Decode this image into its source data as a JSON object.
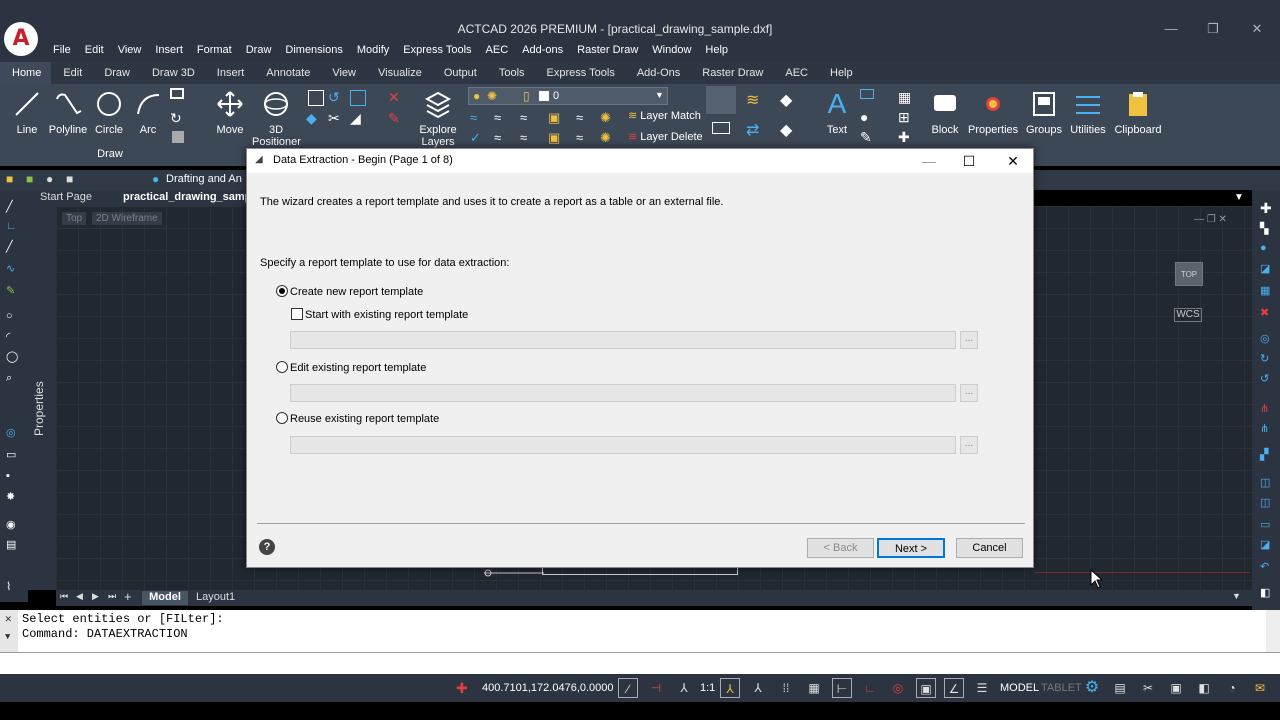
{
  "window": {
    "title": "ACTCAD 2026 PREMIUM - [practical_drawing_sample.dxf]"
  },
  "menu": [
    "File",
    "Edit",
    "View",
    "Insert",
    "Format",
    "Draw",
    "Dimensions",
    "Modify",
    "Express Tools",
    "AEC",
    "Add-ons",
    "Raster Draw",
    "Window",
    "Help"
  ],
  "ribbon_tabs": [
    "Home",
    "Edit",
    "Draw",
    "Draw 3D",
    "Insert",
    "Annotate",
    "View",
    "Visualize",
    "Output",
    "Tools",
    "Express Tools",
    "Add-Ons",
    "Raster Draw",
    "AEC",
    "Help"
  ],
  "ribbon": {
    "line": "Line",
    "polyline": "Polyline",
    "circle": "Circle",
    "arc": "Arc",
    "move": "Move",
    "positioner": "3D Positioner",
    "explore_layers": "Explore Layers",
    "layer_current": "0",
    "layer_match": "Layer Match",
    "layer_delete": "Layer Delete",
    "text": "Text",
    "block": "Block",
    "properties": "Properties",
    "groups": "Groups",
    "utilities": "Utilities",
    "clipboard": "Clipboard",
    "draw_panel": "Draw"
  },
  "workspace": "Drafting and An",
  "file_tabs": [
    "Start Page",
    "practical_drawing_sample"
  ],
  "viewport": {
    "view": "Top",
    "style": "2D Wireframe",
    "cube": "TOP",
    "wcs": "WCS"
  },
  "side_label": "Properties",
  "layout_tabs": [
    "Model",
    "Layout1"
  ],
  "command_lines": [
    "Select entities or [FILter]:",
    "Command: DATAEXTRACTION"
  ],
  "status": {
    "coords": "400.7101,172.0476,0.0000",
    "scale": "1:1",
    "model": "MODEL",
    "tablet": "TABLET"
  },
  "dialog": {
    "title": "Data Extraction - Begin (Page 1 of 8)",
    "intro": "The wizard creates a report template and uses it to create a report as a table or an external file.",
    "prompt": "Specify a report template to use for data extraction:",
    "opt_create": "Create new report template",
    "opt_start_existing": "Start with existing report template",
    "opt_edit": "Edit existing report template",
    "opt_reuse": "Reuse existing report template",
    "browse": "...",
    "back": "< Back",
    "next": "Next >",
    "cancel": "Cancel",
    "help": "?"
  }
}
